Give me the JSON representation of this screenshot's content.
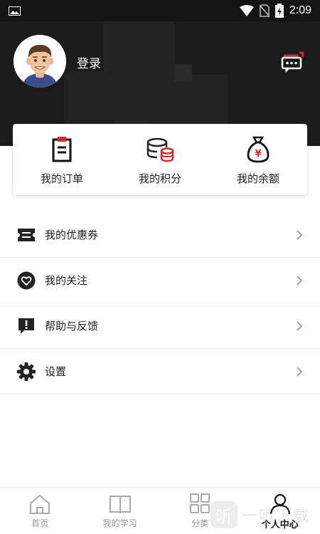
{
  "status_bar": {
    "time": "2:09",
    "icons": [
      "image-icon",
      "wifi-icon",
      "no-sim-icon",
      "battery-charging-icon"
    ]
  },
  "header": {
    "login_label": "登录",
    "avatar_icon": "user-avatar",
    "message_icon": "chat-message-icon"
  },
  "stats": [
    {
      "label": "我的订单",
      "icon": "order-clipboard-icon"
    },
    {
      "label": "我的积分",
      "icon": "points-coins-icon"
    },
    {
      "label": "我的余额",
      "icon": "balance-moneybag-icon"
    }
  ],
  "menu": [
    {
      "label": "我的优惠券",
      "icon": "coupon-icon"
    },
    {
      "label": "我的关注",
      "icon": "heart-icon"
    },
    {
      "label": "帮助与反馈",
      "icon": "feedback-icon"
    },
    {
      "label": "设置",
      "icon": "gear-icon"
    }
  ],
  "bottom_nav": [
    {
      "label": "首页",
      "icon": "home-icon",
      "active": false
    },
    {
      "label": "我的学习",
      "icon": "book-icon",
      "active": false
    },
    {
      "label": "分类",
      "icon": "category-grid-icon",
      "active": false
    },
    {
      "label": "个人中心",
      "icon": "person-icon",
      "active": true
    }
  ],
  "watermark": {
    "glyph": "听",
    "text": "一听下载"
  },
  "colors": {
    "accent_red": "#d9262c",
    "header_bg": "#1b1b1b",
    "text": "#222222"
  }
}
